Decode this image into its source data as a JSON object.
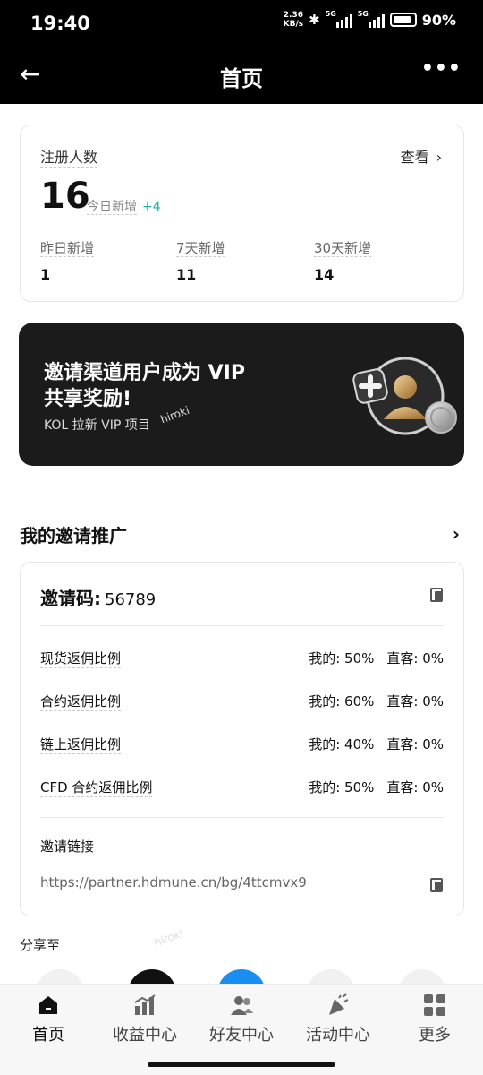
{
  "status": {
    "time": "19:40",
    "speed": "2.36",
    "speed_unit": "KB/s",
    "net1": "5G",
    "net2": "5G",
    "battery": "90%"
  },
  "nav": {
    "title": "首页"
  },
  "registrations": {
    "label": "注册人数",
    "view": "查看",
    "count": "16",
    "today_label": "今日新增",
    "today_delta": "+4",
    "stats": [
      {
        "label": "昨日新增",
        "value": "1"
      },
      {
        "label": "7天新增",
        "value": "11"
      },
      {
        "label": "30天新增",
        "value": "14"
      }
    ]
  },
  "banner": {
    "line1": "邀请渠道用户成为 VIP",
    "line2": "共享奖励!",
    "sub": "KOL 拉新 VIP 项目"
  },
  "invite": {
    "section_title": "我的邀请推广",
    "code_label": "邀请码:",
    "code": "56789",
    "rates": [
      {
        "name": "现货返佣比例",
        "mine": "我的: 50%",
        "direct": "直客: 0%"
      },
      {
        "name": "合约返佣比例",
        "mine": "我的: 60%",
        "direct": "直客: 0%"
      },
      {
        "name": "链上返佣比例",
        "mine": "我的: 40%",
        "direct": "直客: 0%"
      },
      {
        "name": "CFD 合约返佣比例",
        "mine": "我的: 50%",
        "direct": "直客: 0%"
      }
    ],
    "link_label": "邀请链接",
    "link": "https://partner.hdmune.cn/bg/4ttcmvx9"
  },
  "share": {
    "label": "分享至"
  },
  "watermark": "hiroki",
  "tabs": [
    {
      "label": "首页",
      "icon": "home-icon"
    },
    {
      "label": "收益中心",
      "icon": "chart-icon"
    },
    {
      "label": "好友中心",
      "icon": "friends-icon"
    },
    {
      "label": "活动中心",
      "icon": "party-icon"
    },
    {
      "label": "更多",
      "icon": "grid-icon"
    }
  ],
  "colors": {
    "accent": "#1bb5a8",
    "banner_bg": "#1b1b1b",
    "share_blue": "#1a8ef0"
  }
}
